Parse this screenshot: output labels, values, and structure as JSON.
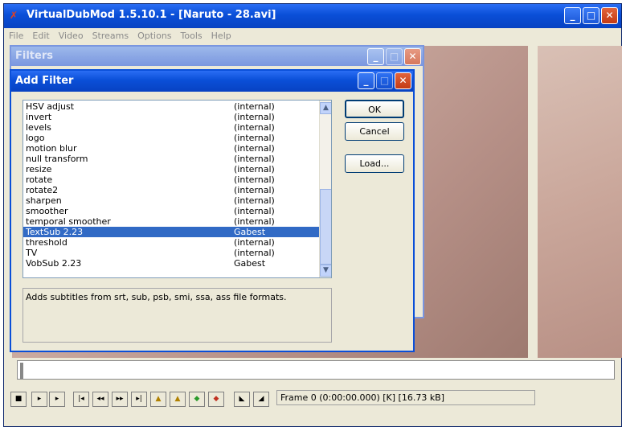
{
  "main_window": {
    "title": "VirtualDubMod 1.5.10.1 - [Naruto - 28.avi]",
    "menu": [
      "File",
      "Edit",
      "Video",
      "Streams",
      "Options",
      "Tools",
      "Help"
    ]
  },
  "status_text": "Frame 0 (0:00:00.000) [K] [16.73 kB]",
  "filters_dialog": {
    "title": "Filters"
  },
  "add_filter_dialog": {
    "title": "Add Filter",
    "buttons": {
      "ok": "OK",
      "cancel": "Cancel",
      "load": "Load..."
    },
    "filters": [
      {
        "name": "HSV adjust",
        "source": "(internal)"
      },
      {
        "name": "invert",
        "source": "(internal)"
      },
      {
        "name": "levels",
        "source": "(internal)"
      },
      {
        "name": "logo",
        "source": "(internal)"
      },
      {
        "name": "motion blur",
        "source": "(internal)"
      },
      {
        "name": "null transform",
        "source": "(internal)"
      },
      {
        "name": "resize",
        "source": "(internal)"
      },
      {
        "name": "rotate",
        "source": "(internal)"
      },
      {
        "name": "rotate2",
        "source": "(internal)"
      },
      {
        "name": "sharpen",
        "source": "(internal)"
      },
      {
        "name": "smoother",
        "source": "(internal)"
      },
      {
        "name": "temporal smoother",
        "source": "(internal)"
      },
      {
        "name": "TextSub 2.23",
        "source": "Gabest",
        "selected": true
      },
      {
        "name": "threshold",
        "source": "(internal)"
      },
      {
        "name": "TV",
        "source": "(internal)"
      },
      {
        "name": "VobSub 2.23",
        "source": "Gabest"
      }
    ],
    "description": "Adds subtitles from srt, sub, psb, smi, ssa, ass file formats."
  }
}
